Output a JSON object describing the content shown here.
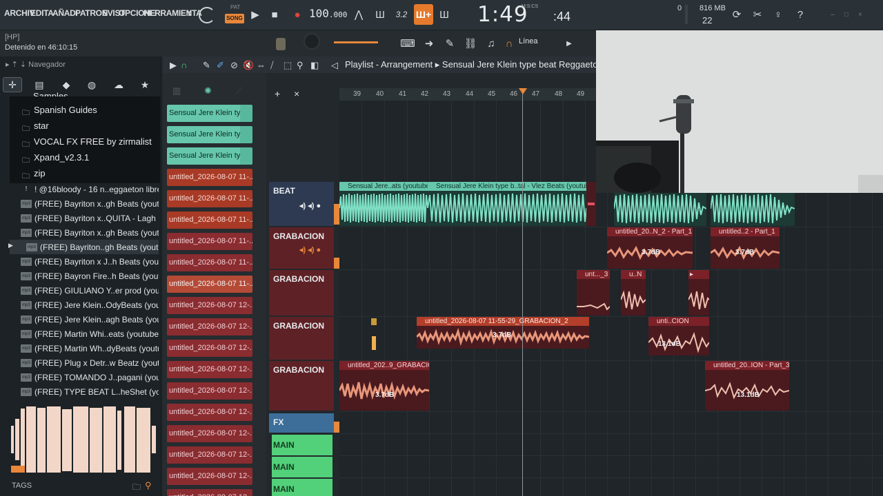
{
  "menu": [
    "ARCHIV",
    "EDITA",
    "AÑADI",
    "PATRON",
    "EVIST",
    "OPCIONE",
    "HERRAMIENTA",
    "Y"
  ],
  "transport": {
    "pat_label": "PAT",
    "song_label": "SONG",
    "tempo": "100",
    "tempo_frac": ".000",
    "time": "1:49",
    "time_frac": ":44",
    "time_unit": "M:S:CS",
    "step_label": "3.2",
    "cpu": "0",
    "memory": "816 MB",
    "polyphony": "22"
  },
  "hint": {
    "title": "[HP]",
    "status": "Detenido en 46:10:15",
    "line_select": "Línea"
  },
  "browser": {
    "nav_label": "Navegador",
    "folders_partial": "Samples",
    "folders": [
      "Spanish Guides",
      "star",
      "VOCAL FX FREE by zirmalist",
      "Xpand_v2.3.1",
      "zip"
    ],
    "files": [
      {
        "name": "! @16bloody - 16 n..eggaeton librería",
        "icon": "exclaim"
      },
      {
        "name": "(FREE) Bayriton x..gh Beats (youtube)",
        "icon": "mp3"
      },
      {
        "name": "(FREE) Bayriton x..QUITA - Lagh Beats",
        "icon": "mp3"
      },
      {
        "name": "(FREE) Bayriton x..gh Beats (youtube)",
        "icon": "mp3"
      },
      {
        "name": "(FREE) Bayriton..gh Beats (youtube)",
        "icon": "mp3",
        "selected": true
      },
      {
        "name": "(FREE) Bayriton x J..h Beats (youtube)",
        "icon": "mp3"
      },
      {
        "name": "(FREE) Bayron Fire..h Beats (youtube)",
        "icon": "mp3"
      },
      {
        "name": "(FREE) GIULIANO Y..er prod (youtube)",
        "icon": "mp3"
      },
      {
        "name": "(FREE) Jere Klein..OdyBeats (youtube)",
        "icon": "mp3"
      },
      {
        "name": "(FREE) Jere Klein..agh Beats (youtube)",
        "icon": "mp3"
      },
      {
        "name": "(FREE) Martin Whi..eats (youtube) (1)",
        "icon": "mp3"
      },
      {
        "name": "(FREE) Martin Wh..dyBeats (youtube)",
        "icon": "mp3"
      },
      {
        "name": "(FREE) Plug x Detr..w Beatz (youtube)",
        "icon": "mp3"
      },
      {
        "name": "(FREE) TOMANDO J..pagani (youtube)",
        "icon": "mp3"
      },
      {
        "name": "(FREE) TYPE BEAT L..heShet (youtube)",
        "icon": "mp3"
      }
    ],
    "tags_label": "TAGS"
  },
  "playlist": {
    "title": "Playlist - Arrangement",
    "song_name": "Sensual Jere Klein type beat",
    "song_genre": "Reggaeto",
    "bar_numbers": [
      "39",
      "40",
      "41",
      "42",
      "43",
      "44",
      "45",
      "46",
      "47",
      "48",
      "49"
    ],
    "clip_sources": [
      {
        "name": "Sensual Jere Klein ty..",
        "kind": "audio"
      },
      {
        "name": "Sensual Jere Klein ty..",
        "kind": "audio"
      },
      {
        "name": "Sensual Jere Klein ty..",
        "kind": "audio"
      },
      {
        "name": "untitled_2026-08-07 11-..",
        "kind": "rec"
      },
      {
        "name": "untitled_2026-08-07 11-..",
        "kind": "rec"
      },
      {
        "name": "untitled_2026-08-07 11-..",
        "kind": "rec"
      },
      {
        "name": "untitled_2026-08-07 11-..",
        "kind": "rec3"
      },
      {
        "name": "untitled_2026-08-07 11-..",
        "kind": "rec3"
      },
      {
        "name": "untitled_2026-08-07 11-..",
        "kind": "rec2"
      },
      {
        "name": "untitled_2026-08-07 12-..",
        "kind": "rec3"
      },
      {
        "name": "untitled_2026-08-07 12-..",
        "kind": "rec3"
      },
      {
        "name": "untitled_2026-08-07 12-..",
        "kind": "rec3"
      },
      {
        "name": "untitled_2026-08-07 12-..",
        "kind": "rec3"
      },
      {
        "name": "untitled_2026-08-07 12-..",
        "kind": "rec3"
      },
      {
        "name": "untitled_2026-08-07 12-..",
        "kind": "rec3"
      },
      {
        "name": "untitled_2026-08-07 12-..",
        "kind": "rec3"
      },
      {
        "name": "untitled_2026-08-07 12-..",
        "kind": "rec3"
      },
      {
        "name": "untitled_2026-08-07 12-..",
        "kind": "rec3"
      },
      {
        "name": "untitled_2026-08-07 12-..",
        "kind": "rec3"
      }
    ],
    "tracks": {
      "beat": "BEAT",
      "grab1": "GRABACION",
      "grab2": "GRABACION",
      "grab3": "GRABACION",
      "grab4": "GRABACION",
      "fx": "FX",
      "main": [
        "MAIN",
        "MAIN",
        "MAIN"
      ]
    },
    "clips": {
      "beat1": "Sensual Jere..ats (youtube)",
      "beat2": "Sensual Jere Klein type b..tal - Vlez Beats (youtube)",
      "grab_a": "untitled_20..N_2 - Part_1",
      "grab_a_db": "3.7dB",
      "grab_b": "untitled..2 - Part_1",
      "grab_b_db": "3.7dB",
      "grab_c": "unt..._3",
      "grab_d": "u..N",
      "grab_e": "untitled_2026-08-07 11-55-29_GRABACION_2",
      "grab_e_db": "3.7dB",
      "grab_f": "unti..CION",
      "grab_f_db": "13.1dB",
      "grab_g": "untitled_202..9_GRABACION",
      "grab_g_db": "3.7dB",
      "grab_h": "untitled_20..ION - Part_3",
      "grab_h_db": "13.1dB"
    }
  },
  "colors": {
    "accent": "#e9883a",
    "audio_clip": "#66c7ac",
    "rec_clip": "#a93a26",
    "beat_track": "#2d3a52",
    "rec_track": "#5e2126",
    "fx_track": "#3c6e99",
    "main_track": "#53d17a"
  }
}
